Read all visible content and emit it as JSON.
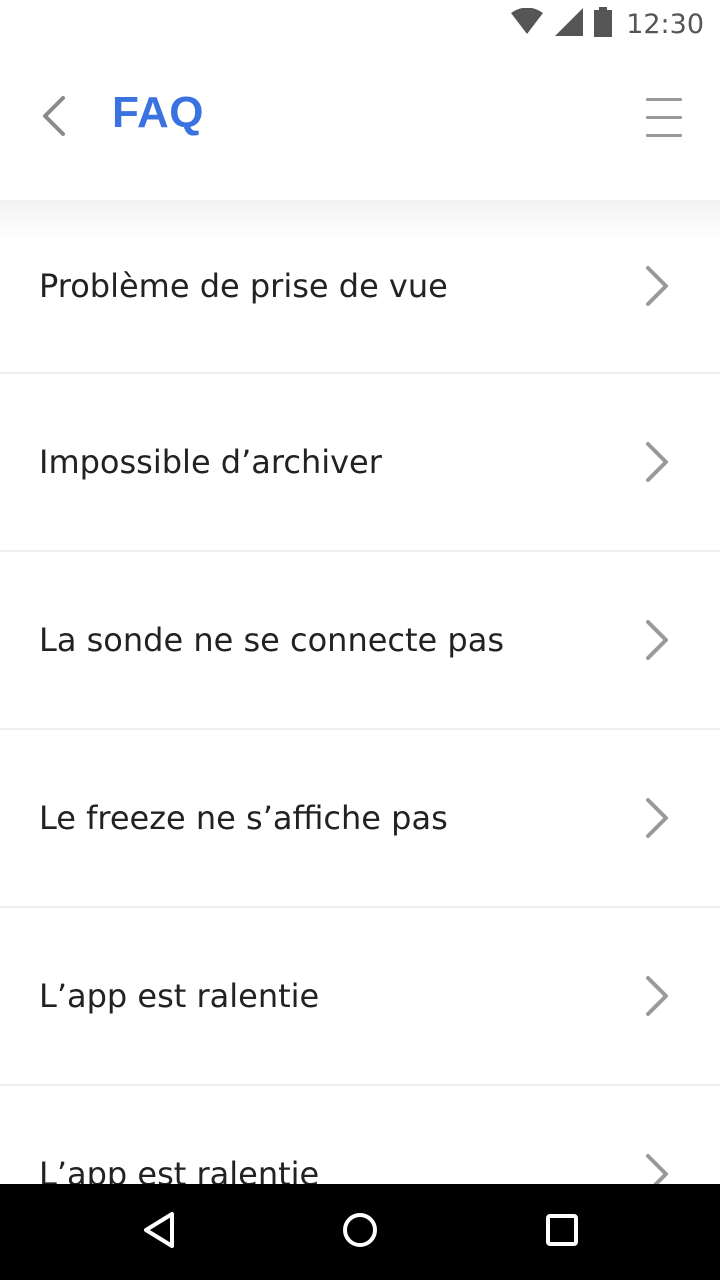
{
  "status_bar": {
    "time": "12:30",
    "icons": [
      "wifi-icon",
      "cell-signal-icon",
      "battery-icon"
    ]
  },
  "app_bar": {
    "title": "FAQ",
    "back_icon": "chevron-left-icon",
    "menu_icon": "hamburger-menu-icon",
    "title_color": "#3a73e0"
  },
  "faq": {
    "items": [
      {
        "label": "Problème de prise de vue"
      },
      {
        "label": "Impossible d’archiver"
      },
      {
        "label": "La sonde ne se connecte pas"
      },
      {
        "label": "Le freeze ne s’affiche pas"
      },
      {
        "label": "L’app est ralentie"
      },
      {
        "label": "L’app est ralentie"
      }
    ],
    "item_icon": "chevron-right-icon"
  },
  "nav_bar": {
    "buttons": [
      "back-triangle-icon",
      "home-circle-icon",
      "recents-square-icon"
    ]
  }
}
